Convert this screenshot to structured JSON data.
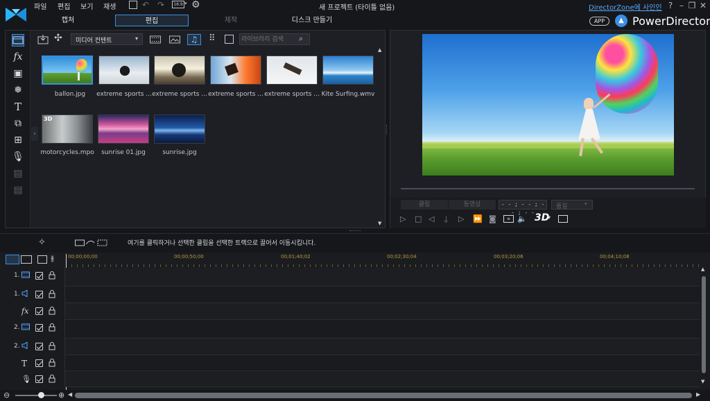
{
  "titlebar": {
    "menu": [
      "파일",
      "편집",
      "보기",
      "재생"
    ],
    "project_title": "새 프로젝트 (타이틀 없음)",
    "signin": "DirectorZone에 사인인",
    "help": "?",
    "app_badge": "APP",
    "brand": "PowerDirector"
  },
  "modes": [
    "캡처",
    "편집",
    "제작",
    "디스크 만들기"
  ],
  "library": {
    "dropdown": "미디어 컨텐트",
    "search_placeholder": "라이브러리 검색",
    "items": [
      {
        "label": "ballon.jpg"
      },
      {
        "label": "extreme sports ..."
      },
      {
        "label": "extreme sports ..."
      },
      {
        "label": "extreme sports ..."
      },
      {
        "label": "extreme sports ..."
      },
      {
        "label": "Kite Surfing.wmv"
      },
      {
        "label": "motorcycles.mpo",
        "badge": "3D"
      },
      {
        "label": "sunrise 01.jpg"
      },
      {
        "label": "sunrise.jpg"
      }
    ]
  },
  "preview": {
    "clip_btn": "클립",
    "movie_btn": "동영상",
    "timecode": "- - ; - - ; - - ; - -",
    "quality": "품질",
    "three_d": "3D"
  },
  "timeline": {
    "hint": "여기를 클릭하거나 선택한 클립을 선택한 트랙으로 끌어서 이동시킵니다.",
    "ruler": [
      "00;00;00;00",
      "00;00;50;00",
      "00;01;40;02",
      "00;02;30;04",
      "00;03;20;06",
      "00;04;10;08"
    ],
    "tracks": [
      {
        "num": "1.",
        "icon": "video-track-icon"
      },
      {
        "num": "1.",
        "icon": "audio-track-icon"
      },
      {
        "num": "",
        "icon": "fx-track-icon"
      },
      {
        "num": "2.",
        "icon": "video-track-icon"
      },
      {
        "num": "2.",
        "icon": "audio-track-icon"
      },
      {
        "num": "",
        "icon": "title-track-icon"
      },
      {
        "num": "",
        "icon": "voice-track-icon"
      }
    ],
    "zoom": 0.62
  },
  "colors": {
    "accent": "#3a8ee6",
    "ruler": "#b79a3c",
    "signin": "#5aa9ff"
  }
}
